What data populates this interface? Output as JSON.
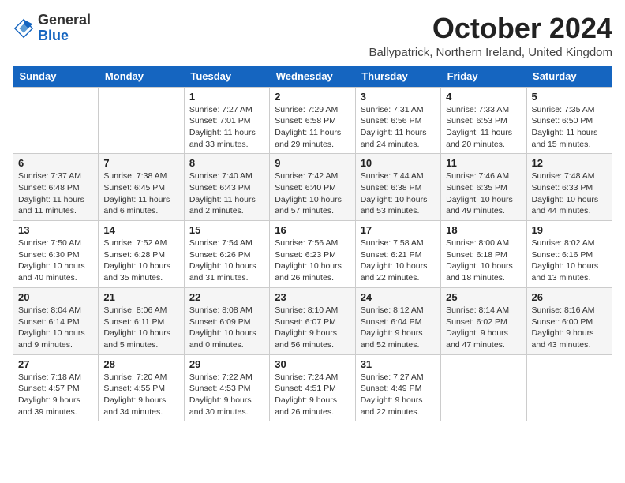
{
  "logo": {
    "general": "General",
    "blue": "Blue"
  },
  "header": {
    "title": "October 2024",
    "location": "Ballypatrick, Northern Ireland, United Kingdom"
  },
  "days_of_week": [
    "Sunday",
    "Monday",
    "Tuesday",
    "Wednesday",
    "Thursday",
    "Friday",
    "Saturday"
  ],
  "weeks": [
    [
      {
        "day": "",
        "info": ""
      },
      {
        "day": "",
        "info": ""
      },
      {
        "day": "1",
        "info": "Sunrise: 7:27 AM\nSunset: 7:01 PM\nDaylight: 11 hours\nand 33 minutes."
      },
      {
        "day": "2",
        "info": "Sunrise: 7:29 AM\nSunset: 6:58 PM\nDaylight: 11 hours\nand 29 minutes."
      },
      {
        "day": "3",
        "info": "Sunrise: 7:31 AM\nSunset: 6:56 PM\nDaylight: 11 hours\nand 24 minutes."
      },
      {
        "day": "4",
        "info": "Sunrise: 7:33 AM\nSunset: 6:53 PM\nDaylight: 11 hours\nand 20 minutes."
      },
      {
        "day": "5",
        "info": "Sunrise: 7:35 AM\nSunset: 6:50 PM\nDaylight: 11 hours\nand 15 minutes."
      }
    ],
    [
      {
        "day": "6",
        "info": "Sunrise: 7:37 AM\nSunset: 6:48 PM\nDaylight: 11 hours\nand 11 minutes."
      },
      {
        "day": "7",
        "info": "Sunrise: 7:38 AM\nSunset: 6:45 PM\nDaylight: 11 hours\nand 6 minutes."
      },
      {
        "day": "8",
        "info": "Sunrise: 7:40 AM\nSunset: 6:43 PM\nDaylight: 11 hours\nand 2 minutes."
      },
      {
        "day": "9",
        "info": "Sunrise: 7:42 AM\nSunset: 6:40 PM\nDaylight: 10 hours\nand 57 minutes."
      },
      {
        "day": "10",
        "info": "Sunrise: 7:44 AM\nSunset: 6:38 PM\nDaylight: 10 hours\nand 53 minutes."
      },
      {
        "day": "11",
        "info": "Sunrise: 7:46 AM\nSunset: 6:35 PM\nDaylight: 10 hours\nand 49 minutes."
      },
      {
        "day": "12",
        "info": "Sunrise: 7:48 AM\nSunset: 6:33 PM\nDaylight: 10 hours\nand 44 minutes."
      }
    ],
    [
      {
        "day": "13",
        "info": "Sunrise: 7:50 AM\nSunset: 6:30 PM\nDaylight: 10 hours\nand 40 minutes."
      },
      {
        "day": "14",
        "info": "Sunrise: 7:52 AM\nSunset: 6:28 PM\nDaylight: 10 hours\nand 35 minutes."
      },
      {
        "day": "15",
        "info": "Sunrise: 7:54 AM\nSunset: 6:26 PM\nDaylight: 10 hours\nand 31 minutes."
      },
      {
        "day": "16",
        "info": "Sunrise: 7:56 AM\nSunset: 6:23 PM\nDaylight: 10 hours\nand 26 minutes."
      },
      {
        "day": "17",
        "info": "Sunrise: 7:58 AM\nSunset: 6:21 PM\nDaylight: 10 hours\nand 22 minutes."
      },
      {
        "day": "18",
        "info": "Sunrise: 8:00 AM\nSunset: 6:18 PM\nDaylight: 10 hours\nand 18 minutes."
      },
      {
        "day": "19",
        "info": "Sunrise: 8:02 AM\nSunset: 6:16 PM\nDaylight: 10 hours\nand 13 minutes."
      }
    ],
    [
      {
        "day": "20",
        "info": "Sunrise: 8:04 AM\nSunset: 6:14 PM\nDaylight: 10 hours\nand 9 minutes."
      },
      {
        "day": "21",
        "info": "Sunrise: 8:06 AM\nSunset: 6:11 PM\nDaylight: 10 hours\nand 5 minutes."
      },
      {
        "day": "22",
        "info": "Sunrise: 8:08 AM\nSunset: 6:09 PM\nDaylight: 10 hours\nand 0 minutes."
      },
      {
        "day": "23",
        "info": "Sunrise: 8:10 AM\nSunset: 6:07 PM\nDaylight: 9 hours\nand 56 minutes."
      },
      {
        "day": "24",
        "info": "Sunrise: 8:12 AM\nSunset: 6:04 PM\nDaylight: 9 hours\nand 52 minutes."
      },
      {
        "day": "25",
        "info": "Sunrise: 8:14 AM\nSunset: 6:02 PM\nDaylight: 9 hours\nand 47 minutes."
      },
      {
        "day": "26",
        "info": "Sunrise: 8:16 AM\nSunset: 6:00 PM\nDaylight: 9 hours\nand 43 minutes."
      }
    ],
    [
      {
        "day": "27",
        "info": "Sunrise: 7:18 AM\nSunset: 4:57 PM\nDaylight: 9 hours\nand 39 minutes."
      },
      {
        "day": "28",
        "info": "Sunrise: 7:20 AM\nSunset: 4:55 PM\nDaylight: 9 hours\nand 34 minutes."
      },
      {
        "day": "29",
        "info": "Sunrise: 7:22 AM\nSunset: 4:53 PM\nDaylight: 9 hours\nand 30 minutes."
      },
      {
        "day": "30",
        "info": "Sunrise: 7:24 AM\nSunset: 4:51 PM\nDaylight: 9 hours\nand 26 minutes."
      },
      {
        "day": "31",
        "info": "Sunrise: 7:27 AM\nSunset: 4:49 PM\nDaylight: 9 hours\nand 22 minutes."
      },
      {
        "day": "",
        "info": ""
      },
      {
        "day": "",
        "info": ""
      }
    ]
  ]
}
